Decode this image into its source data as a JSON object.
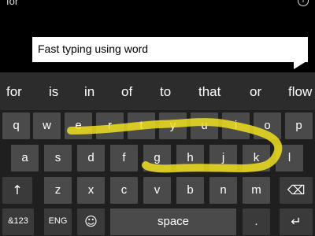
{
  "top": {
    "text": "for",
    "info_icon": "info-icon"
  },
  "bubble": {
    "text": "Fast typing using word"
  },
  "suggestions": [
    "for",
    "is",
    "in",
    "of",
    "to",
    "that",
    "or",
    "flow"
  ],
  "rows": {
    "row1": [
      "q",
      "w",
      "e",
      "r",
      "t",
      "y",
      "u",
      "i",
      "o",
      "p"
    ],
    "row2": [
      "a",
      "s",
      "d",
      "f",
      "g",
      "h",
      "j",
      "k",
      "l"
    ],
    "row3": [
      "z",
      "x",
      "c",
      "v",
      "b",
      "n",
      "m"
    ],
    "row4": {
      "numbers": "&123",
      "lang": "ENG",
      "space": "space"
    }
  },
  "icons": {
    "shift": "shift-up-arrow-icon",
    "backspace": "backspace-icon",
    "emoji": "emoji-icon",
    "enter": "enter-icon"
  },
  "colors": {
    "swipe": "#f0e020",
    "keyboard_bg": "#1f1f1f",
    "key": "#4a4a4a",
    "bubble": "#ffffff"
  }
}
